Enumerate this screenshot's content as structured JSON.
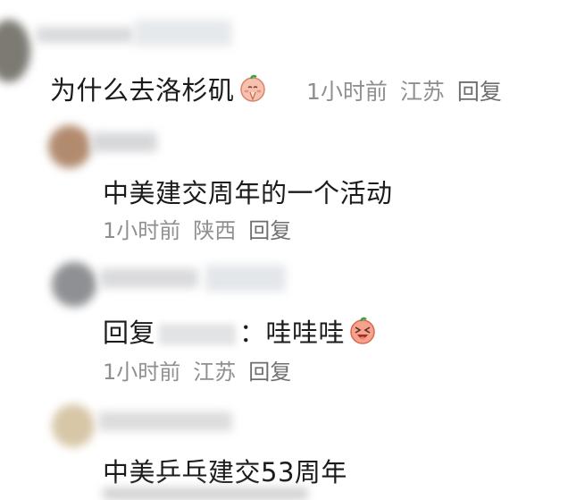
{
  "comments": [
    {
      "text": "为什么去洛杉矶",
      "emoji": "pray-emoji",
      "time": "1小时前",
      "location": "江苏",
      "reply_label": "回复"
    },
    {
      "text": "中美建交周年的一个活动",
      "time": "1小时前",
      "location": "陕西",
      "reply_label": "回复"
    },
    {
      "reply_prefix": "回复",
      "separator": "：",
      "text": "哇哇哇",
      "emoji": "laughing-emoji",
      "time": "1小时前",
      "location": "江苏",
      "reply_label": "回复"
    },
    {
      "text": "中美乒乓建交53周年"
    }
  ]
}
